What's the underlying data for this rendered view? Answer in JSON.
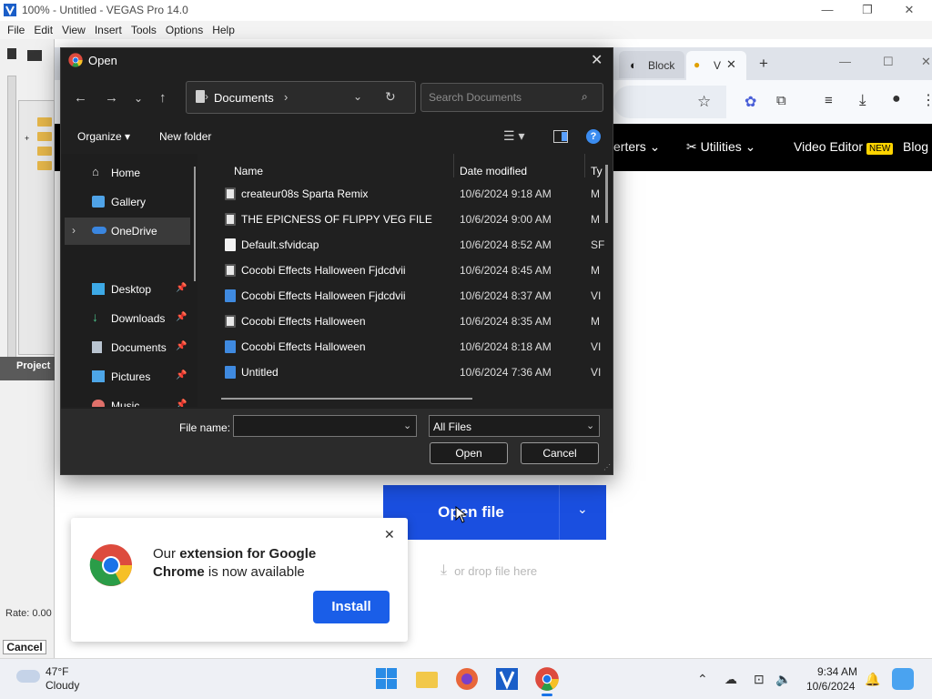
{
  "vegas": {
    "title": "100% - Untitled - VEGAS Pro 14.0",
    "menu": [
      "File",
      "Edit",
      "View",
      "Insert",
      "Tools",
      "Options",
      "Help"
    ],
    "project_tab": "Project",
    "rate_label": "Rate: 0.00",
    "cancel_label": "Cancel"
  },
  "chrome": {
    "tabs": [
      {
        "label": "Block"
      },
      {
        "label": "V"
      }
    ],
    "nav": {
      "converters": "erters",
      "utilities": "Utilities",
      "video_editor": "Video Editor",
      "new_badge": "NEW",
      "blog": "Blog"
    },
    "open_file": "Open file",
    "drop_hint": "or drop file here",
    "promo": {
      "text_pre": "Our ",
      "text_bold": "extension for Google Chrome",
      "text_post": " is now available",
      "install": "Install"
    }
  },
  "dialog": {
    "title": "Open",
    "address_path": "Documents",
    "search_placeholder": "Search Documents",
    "organize": "Organize",
    "new_folder": "New folder",
    "nav_items": [
      {
        "label": "Home",
        "icon": "home-icon",
        "pinned": false
      },
      {
        "label": "Gallery",
        "icon": "gallery-icon",
        "pinned": false
      },
      {
        "label": "OneDrive",
        "icon": "cloud-icon",
        "pinned": false
      },
      {
        "label": "Desktop",
        "icon": "desktop-icon",
        "pinned": true
      },
      {
        "label": "Downloads",
        "icon": "download-icon",
        "pinned": true
      },
      {
        "label": "Documents",
        "icon": "document-icon",
        "pinned": true
      },
      {
        "label": "Pictures",
        "icon": "pictures-icon",
        "pinned": true
      },
      {
        "label": "Music",
        "icon": "music-icon",
        "pinned": true
      }
    ],
    "columns": {
      "name": "Name",
      "date": "Date modified",
      "type": "Ty"
    },
    "files": [
      {
        "name": "createur08s Sparta Remix",
        "date": "10/6/2024 9:18 AM",
        "type": "M",
        "icon": "media-file-icon"
      },
      {
        "name": "THE EPICNESS OF FLIPPY VEG FILE",
        "date": "10/6/2024 9:00 AM",
        "type": "M",
        "icon": "media-file-icon"
      },
      {
        "name": "Default.sfvidcap",
        "date": "10/6/2024 8:52 AM",
        "type": "SF",
        "icon": "blank-file-icon"
      },
      {
        "name": "Cocobi Effects Halloween Fjdcdvii",
        "date": "10/6/2024 8:45 AM",
        "type": "M",
        "icon": "media-file-icon"
      },
      {
        "name": "Cocobi Effects Halloween Fjdcdvii",
        "date": "10/6/2024 8:37 AM",
        "type": "VI",
        "icon": "vegas-file-icon"
      },
      {
        "name": "Cocobi Effects Halloween",
        "date": "10/6/2024 8:35 AM",
        "type": "M",
        "icon": "media-file-icon"
      },
      {
        "name": "Cocobi Effects Halloween",
        "date": "10/6/2024 8:18 AM",
        "type": "VI",
        "icon": "vegas-file-icon"
      },
      {
        "name": "Untitled",
        "date": "10/6/2024 7:36 AM",
        "type": "VI",
        "icon": "vegas-file-icon"
      }
    ],
    "file_name_label": "File name:",
    "file_name_value": "",
    "file_type": "All Files",
    "open": "Open",
    "cancel": "Cancel"
  },
  "taskbar": {
    "temp": "47°F",
    "condition": "Cloudy",
    "time": "9:34 AM",
    "date": "10/6/2024"
  }
}
